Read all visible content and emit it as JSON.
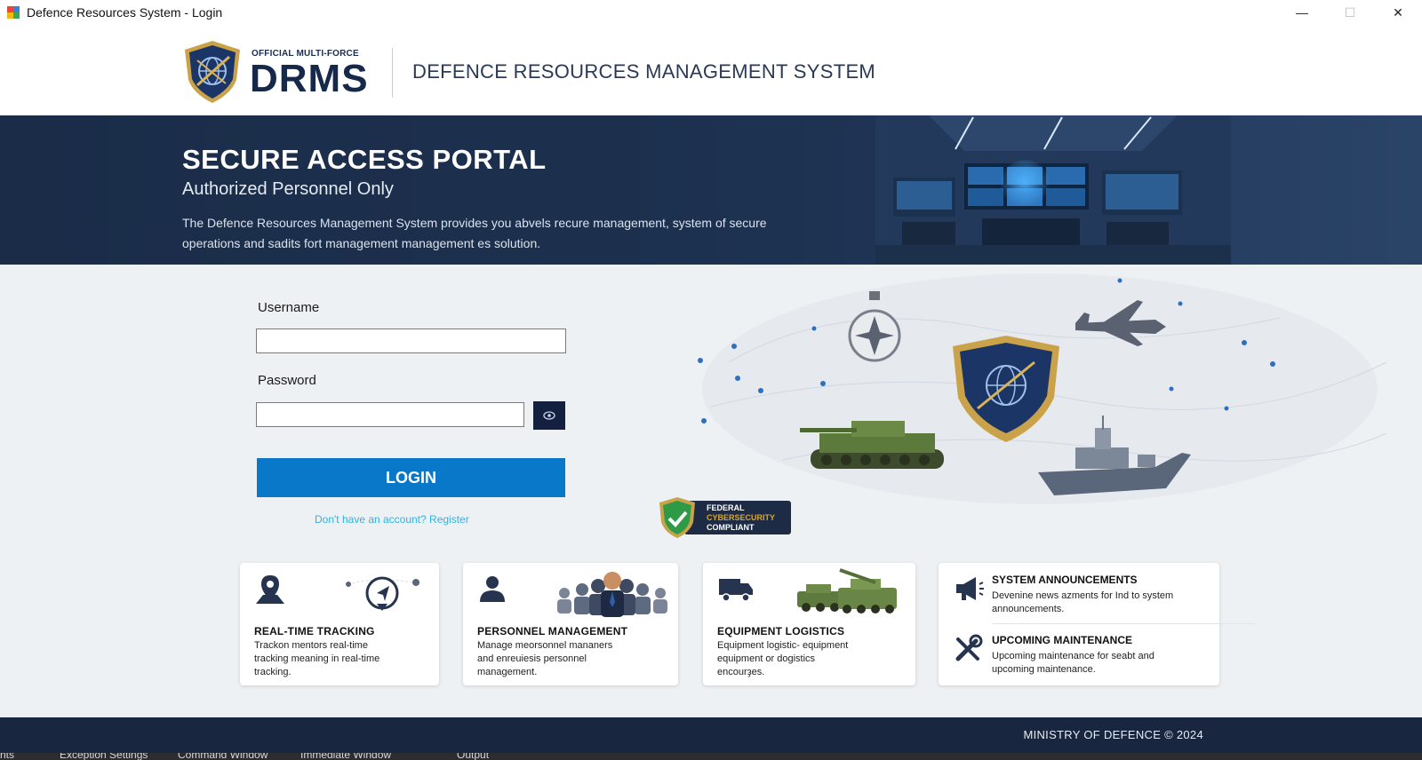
{
  "window": {
    "title": "Defence Resources System - Login",
    "controls": {
      "minimize": "—",
      "maximize": "☐",
      "close": "✕"
    }
  },
  "header": {
    "logo_small": "OFFICIAL MULTI-FORCE",
    "logo_big": "DRMS",
    "title": "DEFENCE RESOURCES MANAGEMENT SYSTEM"
  },
  "hero": {
    "title": "SECURE ACCESS PORTAL",
    "subtitle": "Authorized Personnel Only",
    "description": "The Defence Resources Management System provides you abvels recure management, system of secure operations and sadits fort management management es solution."
  },
  "login": {
    "username_label": "Username",
    "username_value": "",
    "password_label": "Password",
    "password_value": "",
    "login_button": "LOGIN",
    "register_link": "Don't have an account? Register"
  },
  "badge": {
    "line1": "FEDERAL",
    "line2": "CYBERSECURITY",
    "line3": "COMPLIANT"
  },
  "cards": [
    {
      "title": "REAL-TIME TRACKING",
      "desc": [
        "Trackon mentors real-time",
        "tracking meaning in real-time",
        "tracking."
      ],
      "icon": "map-pin-icon"
    },
    {
      "title": "PERSONNEL MANAGEMENT",
      "desc": [
        "Manage meorsonnel mananers",
        "and enreuiesis personnel",
        "management."
      ],
      "icon": "person-icon"
    },
    {
      "title": "EQUIPMENT LOGISTICS",
      "desc": [
        "Equipment logistic- equipment",
        "equipment or dogistics",
        "encourҙes."
      ],
      "icon": "truck-icon"
    }
  ],
  "announcements": [
    {
      "title": "SYSTEM ANNOUNCEMENTS",
      "desc": [
        "Devenine news azments for Ind to system",
        "announcements."
      ],
      "icon": "megaphone-icon"
    },
    {
      "title": "UPCOMING MAINTENANCE",
      "desc": [
        "Upcoming maintenance for seabt and",
        "upcoming maintenance."
      ],
      "icon": "tools-icon"
    }
  ],
  "footer": {
    "text": "MINISTRY OF DEFENCE © 2024"
  },
  "bottom_tabs": [
    "nts",
    "Exception Settings",
    "Command Window",
    "Immediate Window",
    "Output"
  ],
  "colors": {
    "navy": "#18263f",
    "hero": "#1d3150",
    "accent_blue": "#0a78c9",
    "link": "#2db3e6",
    "gold": "#d6a732"
  }
}
